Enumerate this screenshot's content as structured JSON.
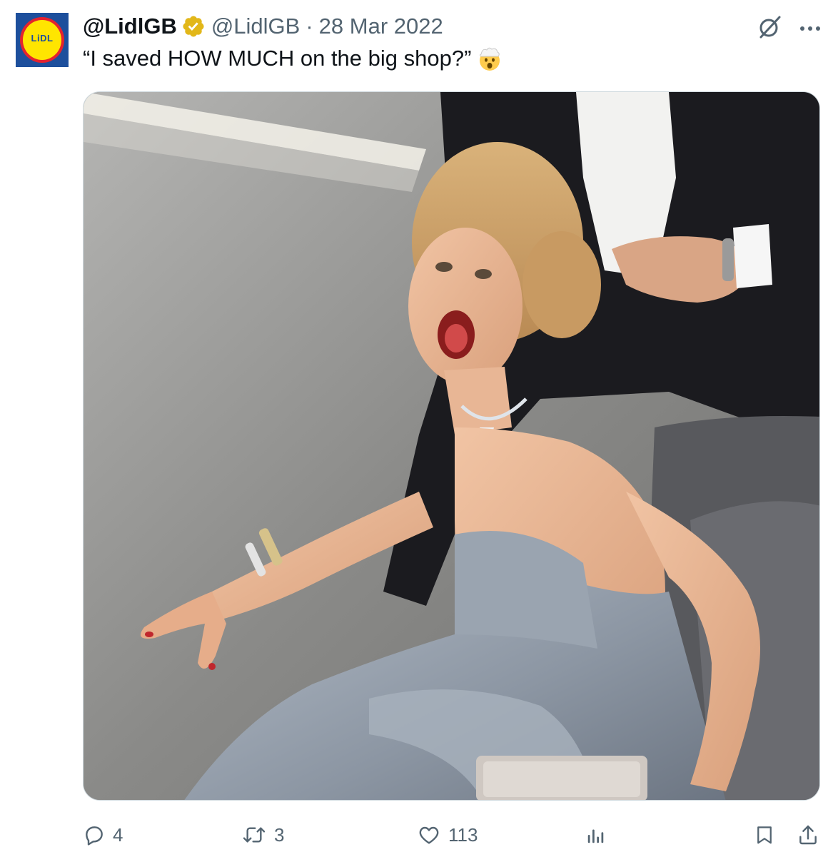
{
  "tweet": {
    "display_name": "@LidlGB",
    "handle": "@LidlGB",
    "separator": "·",
    "date": "28 Mar 2022",
    "text": "“I saved HOW MUCH on the big shop?”",
    "emoji": "exploding-head-emoji",
    "avatar_text": "LiDL"
  },
  "actions": {
    "replies": "4",
    "reposts": "3",
    "likes": "113"
  },
  "icons": {
    "verified": "verified-badge-icon",
    "grok": "grok-icon",
    "more": "more-icon",
    "reply": "reply-icon",
    "repost": "repost-icon",
    "like": "heart-icon",
    "views": "views-icon",
    "bookmark": "bookmark-icon",
    "share": "share-icon"
  },
  "colors": {
    "text": "#0f1419",
    "secondary": "#536471",
    "verified_gold": "#e2b719",
    "lidl_blue": "#1d4f9c",
    "lidl_yellow": "#ffe500",
    "lidl_red": "#e4232e"
  }
}
